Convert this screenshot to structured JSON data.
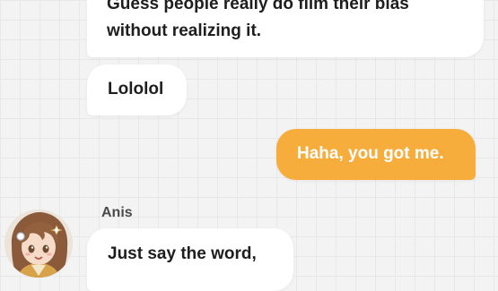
{
  "messages": [
    {
      "from": "character",
      "text": "Guess people really do film their bias without realizing it."
    },
    {
      "from": "character",
      "text": "Lololol"
    },
    {
      "from": "user",
      "text": "Haha, you got me."
    },
    {
      "from": "character",
      "text": "Just say the word,"
    }
  ],
  "sender": {
    "name": "Anis"
  },
  "colors": {
    "background": "#f3f3f3",
    "incoming_bubble": "#ffffff",
    "outgoing_bubble": "#f6ad3c",
    "outgoing_text": "#ffffff"
  },
  "icons": {
    "avatar": "anis-avatar"
  }
}
